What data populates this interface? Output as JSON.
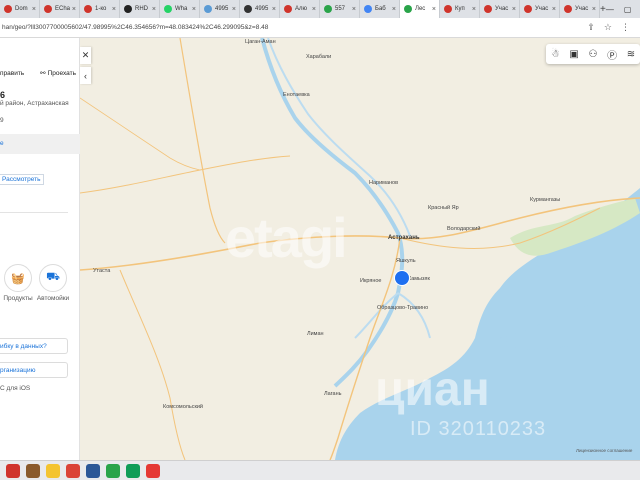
{
  "browser": {
    "tabs": [
      {
        "label": "Dom",
        "icon": "tab-favicon-icon",
        "color": "#d0342c"
      },
      {
        "label": "ECha",
        "icon": "tab-favicon-icon",
        "color": "#d0342c"
      },
      {
        "label": "1-ко",
        "icon": "tab-favicon-icon",
        "color": "#d0342c"
      },
      {
        "label": "RHD",
        "icon": "tab-favicon-icon",
        "color": "#222222"
      },
      {
        "label": "Wha",
        "icon": "tab-favicon-icon",
        "color": "#25d366"
      },
      {
        "label": "4995",
        "icon": "tab-favicon-icon",
        "color": "#5b9bd5"
      },
      {
        "label": "4995",
        "icon": "tab-favicon-icon",
        "color": "#333333"
      },
      {
        "label": "Алю",
        "icon": "tab-favicon-icon",
        "color": "#d0342c"
      },
      {
        "label": "557",
        "icon": "tab-favicon-icon",
        "color": "#2aa44a"
      },
      {
        "label": "Баб",
        "icon": "tab-favicon-icon",
        "color": "#4285f4"
      },
      {
        "label": "Лес",
        "icon": "tab-favicon-icon",
        "color": "#2aa44a",
        "active": true
      },
      {
        "label": "Куп",
        "icon": "tab-favicon-icon",
        "color": "#d0342c"
      },
      {
        "label": "Учас",
        "icon": "tab-favicon-icon",
        "color": "#d0342c"
      },
      {
        "label": "Учас",
        "icon": "tab-favicon-icon",
        "color": "#d0342c"
      },
      {
        "label": "Учас",
        "icon": "tab-favicon-icon",
        "color": "#d0342c"
      }
    ],
    "url": "han/geo/?lll3007700005602/47.98995%2C46.354656?m=48.083424%2C46.299095&z=8.48"
  },
  "sidebar": {
    "route_label": "править",
    "travel_label": "Проехать",
    "title": "6",
    "address": "й район, Астраханская",
    "address2": "9",
    "band_text": "е",
    "view_label": "Рассмотреть",
    "categories": [
      {
        "label": "Продукты",
        "icon": "grocery-basket-icon"
      },
      {
        "label": "Автомойки",
        "icon": "car-wash-icon"
      }
    ],
    "error_button": "ибку в данных?",
    "org_button": "рганизацию",
    "footer": "С для iOS"
  },
  "map": {
    "colors": {
      "land": "#f2eee2",
      "water": "#a9d3ec",
      "road": "#f3c47c",
      "river": "#bcdcf0",
      "green": "#d6e8c4"
    },
    "labels": [
      {
        "text": "Цаган-Аман",
        "cls": "lbl"
      },
      {
        "text": "Харабали",
        "cls": "lbl"
      },
      {
        "text": "Енотаевка",
        "cls": "lbl"
      },
      {
        "text": "Нариманов",
        "cls": "lbl"
      },
      {
        "text": "Красный Яр",
        "cls": "lbl"
      },
      {
        "text": "Курмангазы",
        "cls": "lbl"
      },
      {
        "text": "Володарский",
        "cls": "lbl"
      },
      {
        "text": "Астрахань",
        "cls": "lbl big"
      },
      {
        "text": "Утаста",
        "cls": "lbl"
      },
      {
        "text": "Икряное",
        "cls": "lbl"
      },
      {
        "text": "Камызяк",
        "cls": "lbl"
      },
      {
        "text": "Образцово-Травино",
        "cls": "lbl"
      },
      {
        "text": "Яшкуль",
        "cls": "lbl"
      },
      {
        "text": "Лиман",
        "cls": "lbl"
      },
      {
        "text": "Лагань",
        "cls": "lbl"
      },
      {
        "text": "Комсомольский",
        "cls": "lbl"
      }
    ],
    "watermark_etagi": "etagi",
    "watermark_cian": "циан",
    "watermark_id": "ID 320110233",
    "copyright": "Лицензионное соглашение"
  },
  "taskbar": {
    "icons": [
      {
        "name": "app-icon-1",
        "color": "#d0342c"
      },
      {
        "name": "app-icon-2",
        "color": "#8a5a2b"
      },
      {
        "name": "file-explorer-icon",
        "color": "#f4c430"
      },
      {
        "name": "chrome-icon",
        "color": "#db4437"
      },
      {
        "name": "app-icon-5",
        "color": "#2b5797"
      },
      {
        "name": "app-icon-6",
        "color": "#2aa44a"
      },
      {
        "name": "chrome-icon",
        "color": "#0f9d58"
      },
      {
        "name": "yandex-browser-icon",
        "color": "#e53935"
      }
    ]
  }
}
